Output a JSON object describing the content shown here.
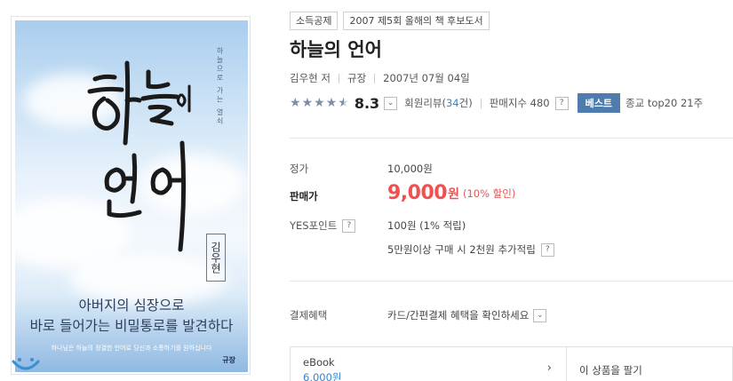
{
  "cover": {
    "side_text": "하늘으로 가는 열쇠",
    "author_box": "김우현",
    "tagline_line1": "아버지의 심장으로",
    "tagline_line2": "바로 들어가는 비밀통로를 발견하다",
    "small_text": "하나님은 하늘의 정결한 언어로 당신과 소통하기를 원하십니다",
    "publisher_logo": "규장"
  },
  "badges": [
    "소득공제",
    "2007 제5회 올해의 책 후보도서"
  ],
  "product": {
    "title": "하늘의 언어",
    "author": "김우현 저",
    "publisher": "규장",
    "date": "2007년 07월 04일"
  },
  "rating": {
    "score": "8.3",
    "review_prefix": "회원리뷰(",
    "review_count": "34",
    "review_suffix": "건)",
    "sales_index": "판매지수 480",
    "best_badge": "베스트",
    "rank": "종교 top20 21주"
  },
  "prices": {
    "list_label": "정가",
    "list_value": "10,000원",
    "sale_label": "판매가",
    "sale_value": "9,000",
    "sale_unit": "원",
    "sale_discount": "(10% 할인)",
    "point_label": "YES포인트",
    "point_value": "100원 (1% 적립)",
    "extra_point": "5만원이상 구매 시 2천원 추가적립",
    "benefit_label": "결제혜택",
    "benefit_value": "카드/간편결제 혜택을 확인하세요"
  },
  "ebook": {
    "label": "eBook",
    "price": "6,000원"
  },
  "sell": {
    "label": "이 상품을 팔기"
  },
  "colors": {
    "accent_red": "#f05050",
    "best_badge_bg": "#4e7cad",
    "link_blue": "#3b82c4"
  }
}
